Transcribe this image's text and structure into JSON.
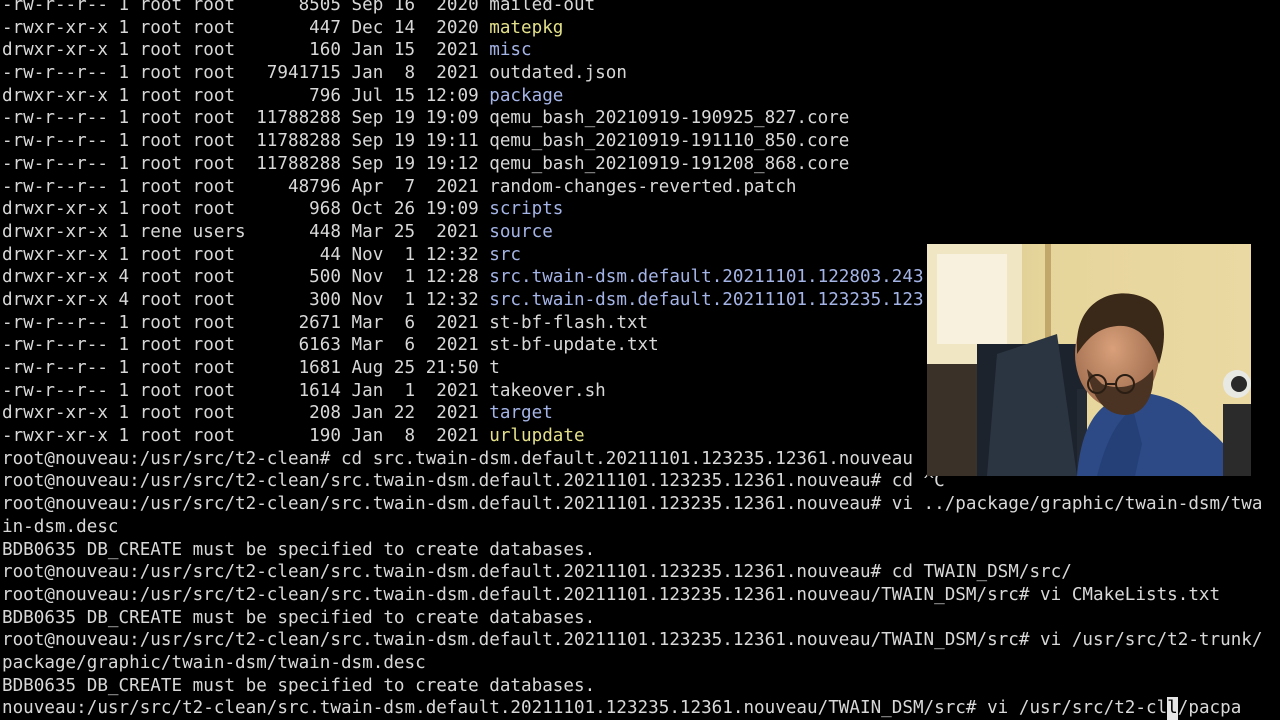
{
  "colors": {
    "background": "#000000",
    "text": "#d8d8d8",
    "executable": "#e3e08a",
    "directory": "#a4b4e6"
  },
  "terminal": {
    "lines": [
      [
        {
          "t": "-rw-r--r-- 1 root root      8505 Sep 16  2020 ",
          "c": "text"
        },
        {
          "t": "mailed-out",
          "c": "text"
        }
      ],
      [
        {
          "t": "-rwxr-xr-x 1 root root       447 Dec 14  2020 ",
          "c": "text"
        },
        {
          "t": "matepkg",
          "c": "exec"
        }
      ],
      [
        {
          "t": "drwxr-xr-x 1 root root       160 Jan 15  2021 ",
          "c": "text"
        },
        {
          "t": "misc",
          "c": "dir"
        }
      ],
      [
        {
          "t": "-rw-r--r-- 1 root root   7941715 Jan  8  2021 ",
          "c": "text"
        },
        {
          "t": "outdated.json",
          "c": "text"
        }
      ],
      [
        {
          "t": "drwxr-xr-x 1 root root       796 Jul 15 12:09 ",
          "c": "text"
        },
        {
          "t": "package",
          "c": "dir"
        }
      ],
      [
        {
          "t": "-rw-r--r-- 1 root root  11788288 Sep 19 19:09 ",
          "c": "text"
        },
        {
          "t": "qemu_bash_20210919-190925_827.core",
          "c": "text"
        }
      ],
      [
        {
          "t": "-rw-r--r-- 1 root root  11788288 Sep 19 19:11 ",
          "c": "text"
        },
        {
          "t": "qemu_bash_20210919-191110_850.core",
          "c": "text"
        }
      ],
      [
        {
          "t": "-rw-r--r-- 1 root root  11788288 Sep 19 19:12 ",
          "c": "text"
        },
        {
          "t": "qemu_bash_20210919-191208_868.core",
          "c": "text"
        }
      ],
      [
        {
          "t": "-rw-r--r-- 1 root root     48796 Apr  7  2021 ",
          "c": "text"
        },
        {
          "t": "random-changes-reverted.patch",
          "c": "text"
        }
      ],
      [
        {
          "t": "drwxr-xr-x 1 root root       968 Oct 26 19:09 ",
          "c": "text"
        },
        {
          "t": "scripts",
          "c": "dir"
        }
      ],
      [
        {
          "t": "drwxr-xr-x 1 rene users      448 Mar 25  2021 ",
          "c": "text"
        },
        {
          "t": "source",
          "c": "dir"
        }
      ],
      [
        {
          "t": "drwxr-xr-x 1 root root        44 Nov  1 12:32 ",
          "c": "text"
        },
        {
          "t": "src",
          "c": "dir"
        }
      ],
      [
        {
          "t": "drwxr-xr-x 4 root root       500 Nov  1 12:28 ",
          "c": "text"
        },
        {
          "t": "src.twain-dsm.default.20211101.122803.243",
          "c": "dir"
        }
      ],
      [
        {
          "t": "drwxr-xr-x 4 root root       300 Nov  1 12:32 ",
          "c": "text"
        },
        {
          "t": "src.twain-dsm.default.20211101.123235.123",
          "c": "dir"
        }
      ],
      [
        {
          "t": "-rw-r--r-- 1 root root      2671 Mar  6  2021 ",
          "c": "text"
        },
        {
          "t": "st-bf-flash.txt",
          "c": "text"
        }
      ],
      [
        {
          "t": "-rw-r--r-- 1 root root      6163 Mar  6  2021 ",
          "c": "text"
        },
        {
          "t": "st-bf-update.txt",
          "c": "text"
        }
      ],
      [
        {
          "t": "-rw-r--r-- 1 root root      1681 Aug 25 21:50 ",
          "c": "text"
        },
        {
          "t": "t",
          "c": "text"
        }
      ],
      [
        {
          "t": "-rw-r--r-- 1 root root      1614 Jan  1  2021 ",
          "c": "text"
        },
        {
          "t": "takeover.sh",
          "c": "text"
        }
      ],
      [
        {
          "t": "drwxr-xr-x 1 root root       208 Jan 22  2021 ",
          "c": "text"
        },
        {
          "t": "target",
          "c": "dir"
        }
      ],
      [
        {
          "t": "-rwxr-xr-x 1 root root       190 Jan  8  2021 ",
          "c": "text"
        },
        {
          "t": "urlupdate",
          "c": "exec"
        }
      ],
      [
        {
          "t": "root@nouveau:/usr/src/t2-clean# cd src.twain-dsm.default.20211101.123235.12361.nouveau",
          "c": "text"
        }
      ],
      [
        {
          "t": "root@nouveau:/usr/src/t2-clean/src.twain-dsm.default.20211101.123235.12361.nouveau# cd ^C",
          "c": "text"
        }
      ],
      [
        {
          "t": "root@nouveau:/usr/src/t2-clean/src.twain-dsm.default.20211101.123235.12361.nouveau# vi ../package/graphic/twain-dsm/twa",
          "c": "text"
        }
      ],
      [
        {
          "t": "in-dsm.desc",
          "c": "text"
        }
      ],
      [
        {
          "t": "BDB0635 DB_CREATE must be specified to create databases.",
          "c": "text"
        }
      ],
      [
        {
          "t": "root@nouveau:/usr/src/t2-clean/src.twain-dsm.default.20211101.123235.12361.nouveau# cd TWAIN_DSM/src/",
          "c": "text"
        }
      ],
      [
        {
          "t": "root@nouveau:/usr/src/t2-clean/src.twain-dsm.default.20211101.123235.12361.nouveau/TWAIN_DSM/src# vi CMakeLists.txt",
          "c": "text"
        }
      ],
      [
        {
          "t": "BDB0635 DB_CREATE must be specified to create databases.",
          "c": "text"
        }
      ],
      [
        {
          "t": "root@nouveau:/usr/src/t2-clean/src.twain-dsm.default.20211101.123235.12361.nouveau/TWAIN_DSM/src# vi /usr/src/t2-trunk/",
          "c": "text"
        }
      ],
      [
        {
          "t": "package/graphic/twain-dsm/twain-dsm.desc",
          "c": "text"
        }
      ],
      [
        {
          "t": "BDB0635 DB_CREATE must be specified to create databases.                                                                 oot@",
          "c": "text"
        }
      ]
    ],
    "last_line": {
      "before": "nouveau:/usr/src/t2-clean/src.twain-dsm.default.20211101.123235.12361.nouveau/TWAIN_DSM/src# vi /usr/src/t2-cl",
      "cursor": "l",
      "after": "/pacpa"
    }
  }
}
